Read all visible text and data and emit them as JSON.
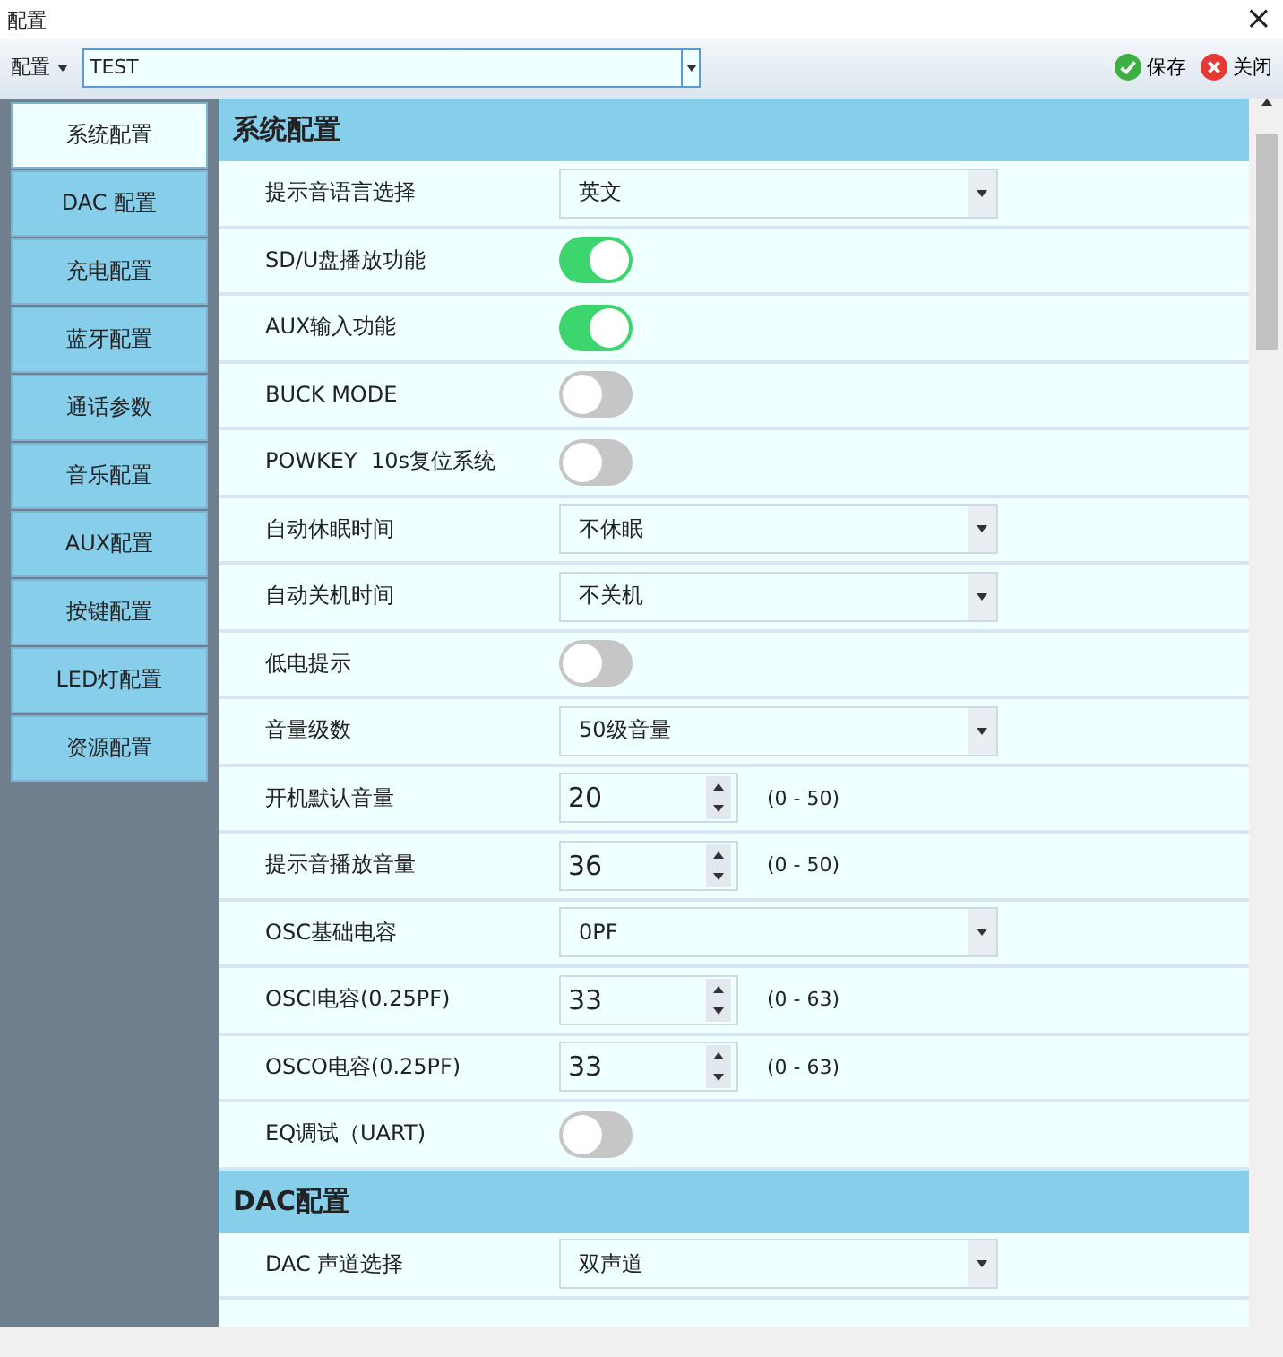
{
  "window": {
    "title": "配置",
    "close": "×"
  },
  "toolbar": {
    "menu": "配置",
    "config": "TEST",
    "save": "保存",
    "close": "关闭"
  },
  "sidebar": {
    "items": [
      {
        "label": "系统配置",
        "selected": true
      },
      {
        "label": "DAC 配置",
        "selected": false
      },
      {
        "label": "充电配置",
        "selected": false
      },
      {
        "label": "蓝牙配置",
        "selected": false
      },
      {
        "label": "通话参数",
        "selected": false
      },
      {
        "label": "音乐配置",
        "selected": false
      },
      {
        "label": "AUX配置",
        "selected": false
      },
      {
        "label": "按键配置",
        "selected": false
      },
      {
        "label": "LED灯配置",
        "selected": false
      },
      {
        "label": "资源配置",
        "selected": false
      }
    ]
  },
  "sections": [
    {
      "title": "系统配置",
      "rows": [
        {
          "kind": "select",
          "label": "提示音语言选择",
          "value": "英文"
        },
        {
          "kind": "toggle",
          "label": "SD/U盘播放功能",
          "on": true
        },
        {
          "kind": "toggle",
          "label": "AUX输入功能",
          "on": true
        },
        {
          "kind": "toggle",
          "label": "BUCK MODE",
          "on": false
        },
        {
          "kind": "toggle",
          "label": "POWKEY  10s复位系统",
          "on": false
        },
        {
          "kind": "select",
          "label": "自动休眠时间",
          "value": "不休眠"
        },
        {
          "kind": "select",
          "label": "自动关机时间",
          "value": "不关机"
        },
        {
          "kind": "toggle",
          "label": "低电提示",
          "on": false
        },
        {
          "kind": "select",
          "label": "音量级数",
          "value": "50级音量"
        },
        {
          "kind": "spin",
          "label": "开机默认音量",
          "value": "20",
          "range": "(0 - 50)"
        },
        {
          "kind": "spin",
          "label": "提示音播放音量",
          "value": "36",
          "range": "(0 - 50)"
        },
        {
          "kind": "select",
          "label": "OSC基础电容",
          "value": "0PF"
        },
        {
          "kind": "spin",
          "label": "OSCI电容(0.25PF)",
          "value": "33",
          "range": "(0 - 63)"
        },
        {
          "kind": "spin",
          "label": "OSCO电容(0.25PF)",
          "value": "33",
          "range": "(0 - 63)"
        },
        {
          "kind": "toggle",
          "label": "EQ调试（UART)",
          "on": false
        }
      ]
    },
    {
      "title": "DAC配置",
      "rows": [
        {
          "kind": "select",
          "label": "DAC 声道选择",
          "value": "双声道"
        }
      ]
    }
  ]
}
